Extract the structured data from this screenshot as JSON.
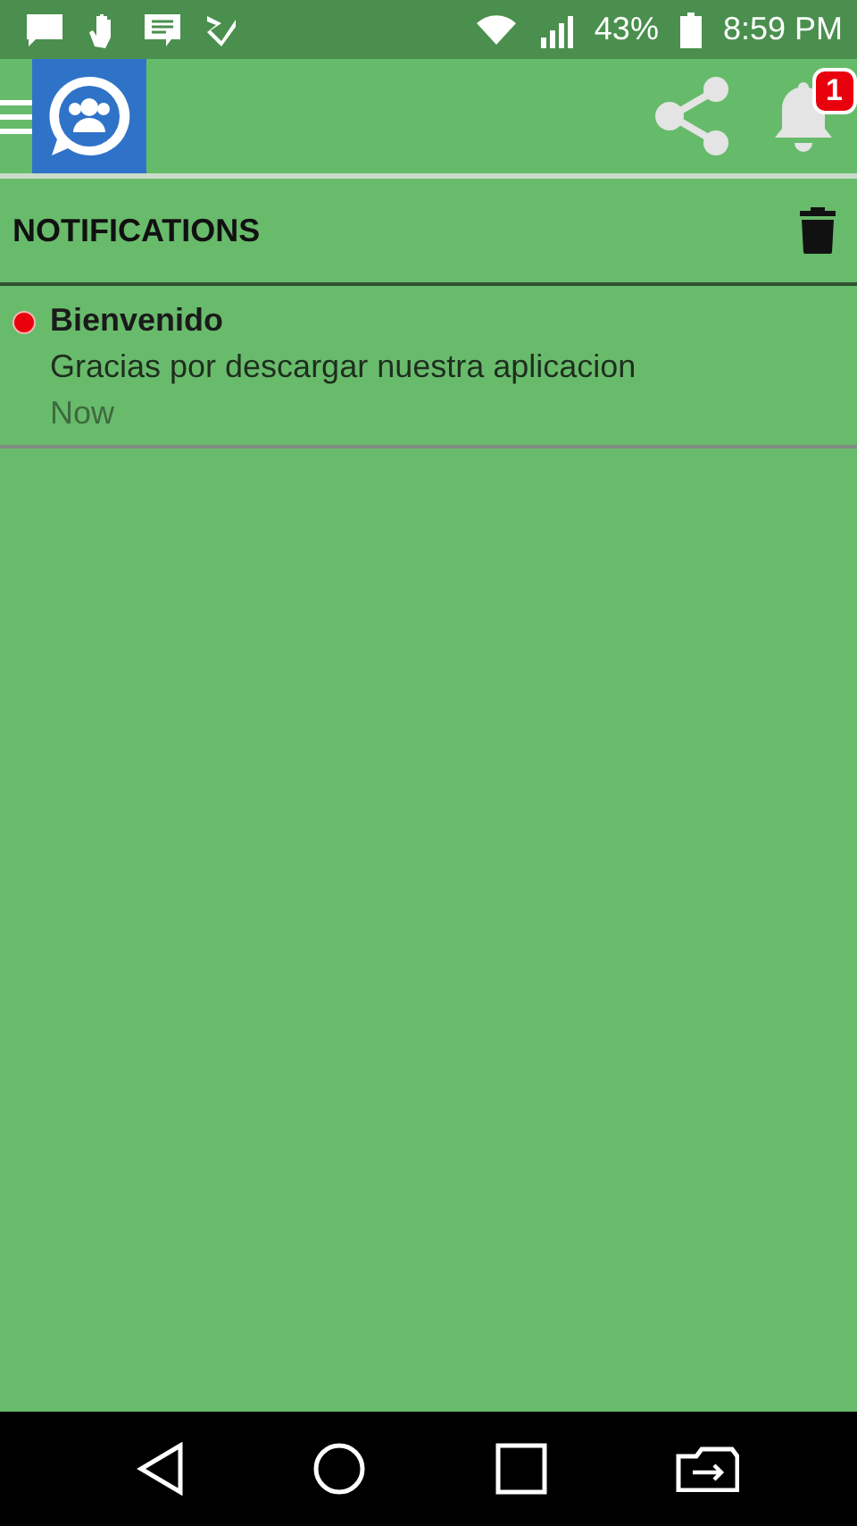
{
  "status_bar": {
    "battery": "43%",
    "time": "8:59 PM"
  },
  "toolbar": {
    "notification_badge": "1"
  },
  "section": {
    "title": "NOTIFICATIONS"
  },
  "notifications": [
    {
      "title": "Bienvenido",
      "message": "Gracias por descargar nuestra aplicacion",
      "time": "Now",
      "unread": true
    }
  ]
}
